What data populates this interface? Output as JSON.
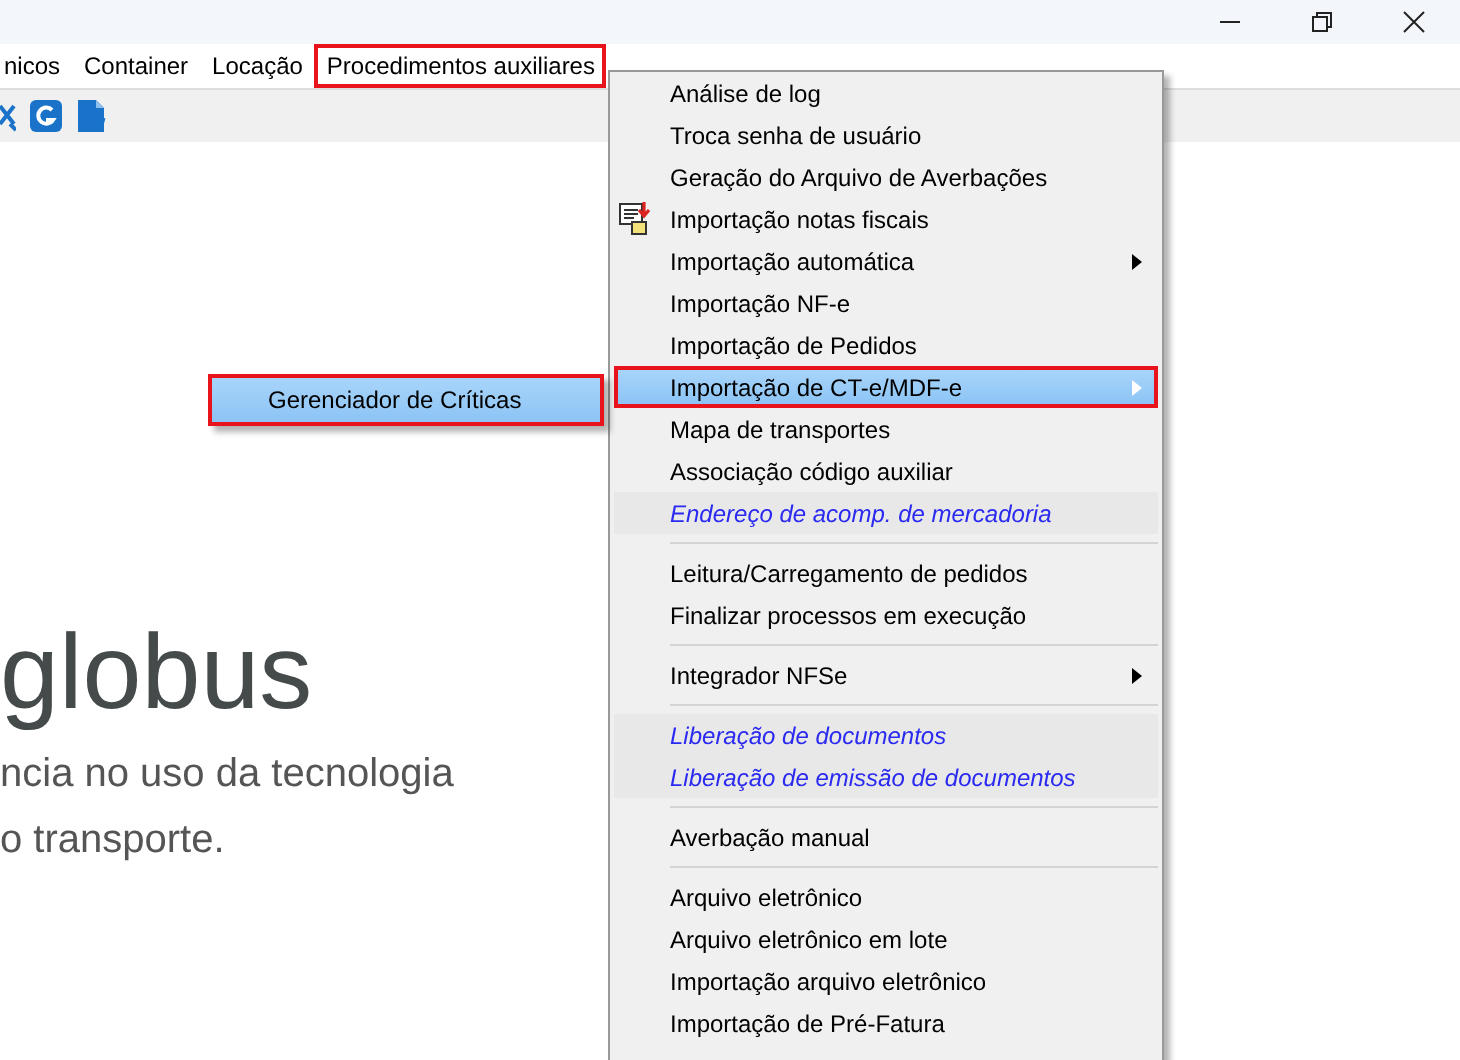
{
  "menu_bar": [
    {
      "label": "nicos",
      "highlighted": false
    },
    {
      "label": "Container",
      "highlighted": false
    },
    {
      "label": "Locação",
      "highlighted": false
    },
    {
      "label": "Procedimentos auxiliares",
      "highlighted": true
    }
  ],
  "toolbar": [
    {
      "kind": "tools"
    },
    {
      "kind": "badge"
    },
    {
      "kind": "document"
    }
  ],
  "brand": {
    "name": "globus",
    "tagline": [
      "ncia no uso da tecnologia",
      "o transporte."
    ]
  },
  "dropdown": [
    {
      "kind": "item",
      "label": "Análise de log",
      "selected": false,
      "submenu": false,
      "highlighted": false
    },
    {
      "kind": "item",
      "label": "Troca senha de usuário",
      "selected": false,
      "submenu": false,
      "highlighted": false
    },
    {
      "kind": "item",
      "label": "Geração do Arquivo de Averbações",
      "selected": false,
      "submenu": false,
      "highlighted": false
    },
    {
      "kind": "item",
      "label": "Importação notas fiscais",
      "selected": false,
      "submenu": false,
      "highlighted": false,
      "icon": true
    },
    {
      "kind": "item",
      "label": "Importação automática",
      "selected": false,
      "submenu": true,
      "highlighted": false
    },
    {
      "kind": "item",
      "label": "Importação NF-e",
      "selected": false,
      "submenu": false,
      "highlighted": false
    },
    {
      "kind": "item",
      "label": "Importação de Pedidos",
      "selected": false,
      "submenu": false,
      "highlighted": false
    },
    {
      "kind": "item",
      "label": "Importação de CT-e/MDF-e",
      "selected": true,
      "submenu": true,
      "highlighted": true
    },
    {
      "kind": "item",
      "label": "Mapa de transportes",
      "selected": false,
      "submenu": false,
      "highlighted": false
    },
    {
      "kind": "item",
      "label": "Associação código auxiliar",
      "selected": false,
      "submenu": false,
      "highlighted": false
    },
    {
      "kind": "link",
      "label": "Endereço de acomp. de mercadoria",
      "selected": false,
      "submenu": false,
      "highlighted": false
    },
    {
      "kind": "separator"
    },
    {
      "kind": "item",
      "label": "Leitura/Carregamento de pedidos",
      "selected": false,
      "submenu": false,
      "highlighted": false
    },
    {
      "kind": "item",
      "label": "Finalizar processos em execução",
      "selected": false,
      "submenu": false,
      "highlighted": false
    },
    {
      "kind": "separator"
    },
    {
      "kind": "item",
      "label": "Integrador NFSe",
      "selected": false,
      "submenu": true,
      "highlighted": false
    },
    {
      "kind": "separator"
    },
    {
      "kind": "link",
      "label": "Liberação de documentos",
      "selected": false,
      "submenu": false,
      "highlighted": false
    },
    {
      "kind": "link",
      "label": "Liberação de emissão de documentos",
      "selected": false,
      "submenu": false,
      "highlighted": false
    },
    {
      "kind": "separator"
    },
    {
      "kind": "item",
      "label": "Averbação manual",
      "selected": false,
      "submenu": false,
      "highlighted": false
    },
    {
      "kind": "separator"
    },
    {
      "kind": "item",
      "label": "Arquivo eletrônico",
      "selected": false,
      "submenu": false,
      "highlighted": false
    },
    {
      "kind": "item",
      "label": "Arquivo eletrônico em lote",
      "selected": false,
      "submenu": false,
      "highlighted": false
    },
    {
      "kind": "item",
      "label": "Importação arquivo eletrônico",
      "selected": false,
      "submenu": false,
      "highlighted": false
    },
    {
      "kind": "item",
      "label": "Importação de Pré-Fatura",
      "selected": false,
      "submenu": false,
      "highlighted": false
    }
  ],
  "submenu": [
    {
      "label": "Gerenciador de Críticas",
      "selected": true,
      "highlighted": true
    }
  ]
}
